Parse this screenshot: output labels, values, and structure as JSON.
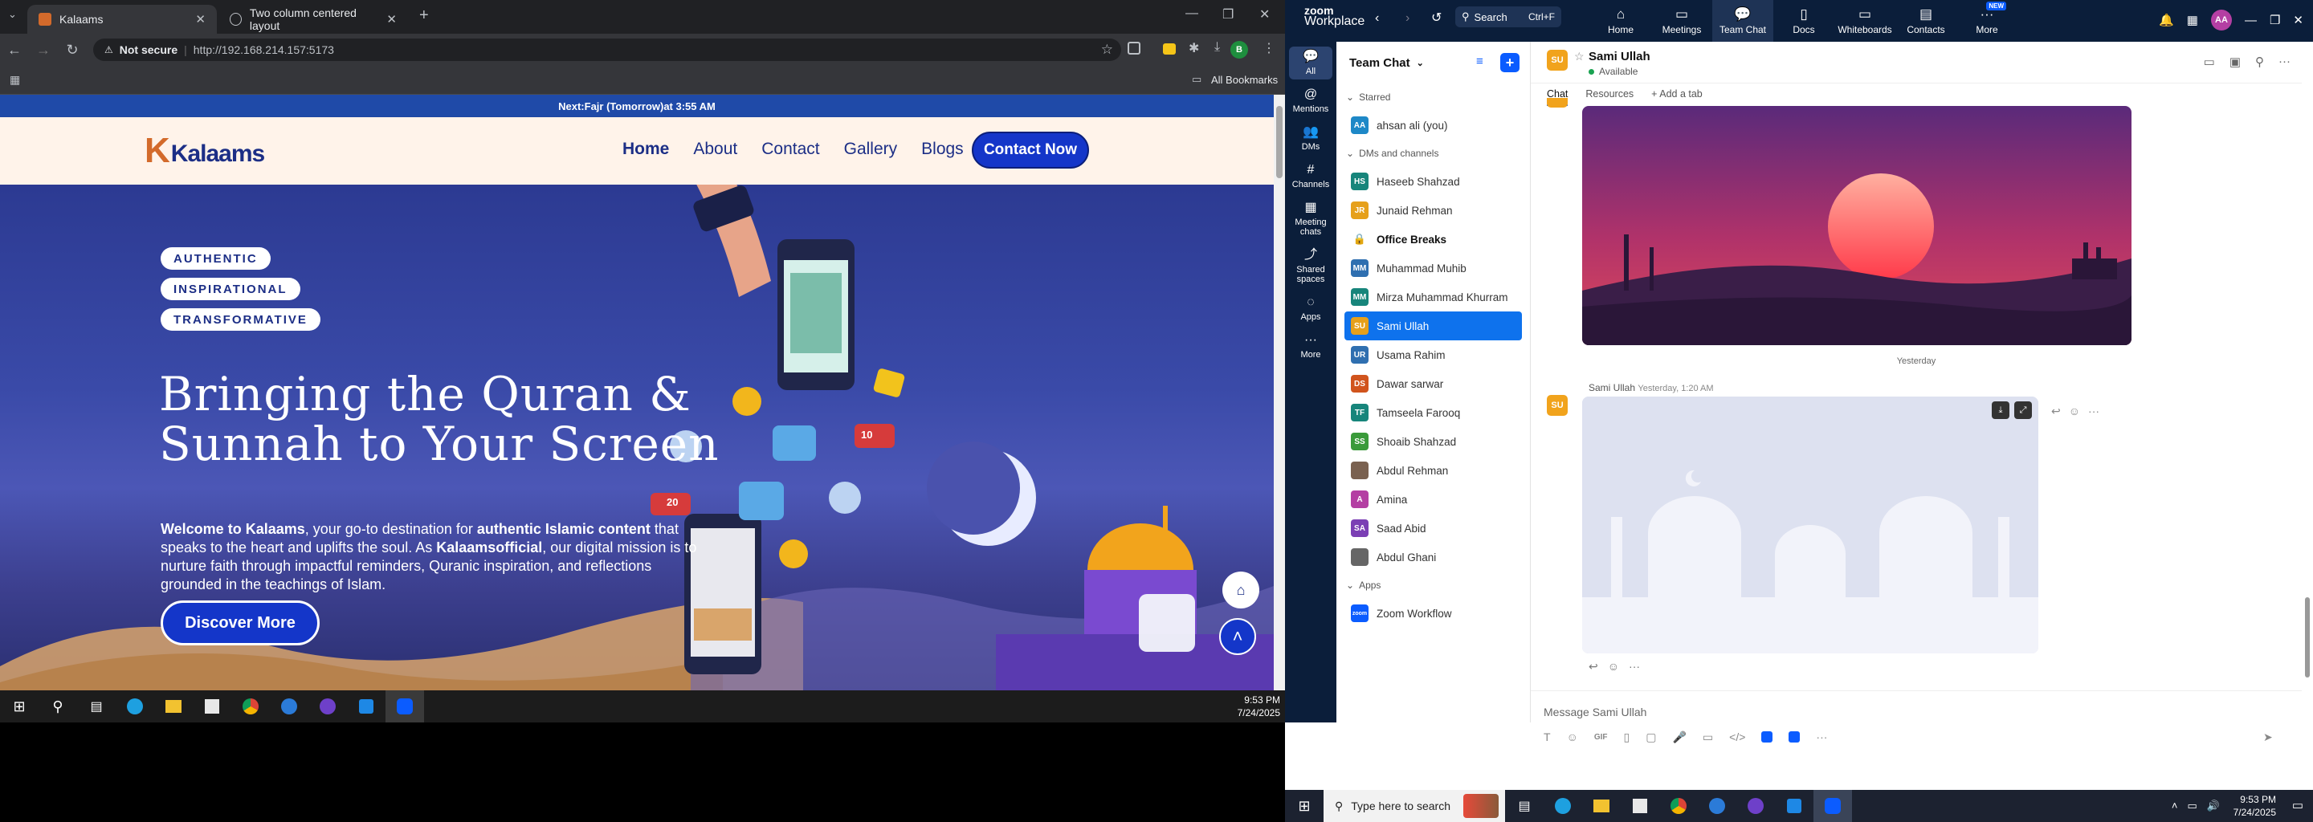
{
  "browser": {
    "tabs": [
      {
        "title": "Kalaams",
        "active": true
      },
      {
        "title": "Two column centered layout",
        "active": false
      }
    ],
    "address": {
      "security": "Not secure",
      "url": "http://192.168.214.157:5173"
    },
    "bookmarks_label": "All Bookmarks",
    "profile_initial": "B"
  },
  "site": {
    "prayer_bar": {
      "prefix": "Next: ",
      "prayer": "Fajr (Tomorrow)",
      "suffix": " at 3:55 AM"
    },
    "logo": {
      "mark": "K",
      "text": "Kalaams"
    },
    "nav": [
      "Home",
      "About",
      "Contact",
      "Gallery",
      "Blogs"
    ],
    "cta": "Contact Now",
    "chips": [
      "AUTHENTIC",
      "INSPIRATIONAL",
      "TRANSFORMATIVE"
    ],
    "headline": [
      "Bringing the Quran &",
      "Sunnah to Your Screen"
    ],
    "lead": {
      "p1": "Welcome to Kalaams",
      "p2": ", your go-to destination for ",
      "p3": "authentic Islamic content",
      "p4": " that speaks to the heart and uplifts the soul. As ",
      "p5": "Kalaamsofficial",
      "p6": ", our digital mission is to nurture faith through impactful reminders, Quranic inspiration, and reflections grounded in the teachings of Islam."
    },
    "discover": "Discover More",
    "deco": {
      "like_count": "20",
      "hearts": "10"
    }
  },
  "left_taskbar": {
    "time": "9:53 PM",
    "date": "7/24/2025"
  },
  "zoom": {
    "brand_top": "zoom",
    "brand_bottom": "Workplace",
    "search": {
      "label": "Search",
      "shortcut": "Ctrl+F"
    },
    "nav": [
      {
        "label": "Home",
        "icon": "home-icon"
      },
      {
        "label": "Meetings",
        "icon": "video-icon"
      },
      {
        "label": "Team Chat",
        "icon": "chat-icon",
        "active": true
      },
      {
        "label": "Docs",
        "icon": "doc-icon"
      },
      {
        "label": "Whiteboards",
        "icon": "whiteboard-icon"
      },
      {
        "label": "Contacts",
        "icon": "contacts-icon"
      },
      {
        "label": "More",
        "icon": "more-icon",
        "badge": "NEW"
      }
    ],
    "avatar": "AA",
    "rail": [
      {
        "label": "All",
        "active": true
      },
      {
        "label": "Mentions"
      },
      {
        "label": "DMs"
      },
      {
        "label": "Channels"
      },
      {
        "label": "Meeting chats"
      },
      {
        "label": "Shared spaces"
      },
      {
        "label": "Apps"
      },
      {
        "label": "More"
      }
    ],
    "list_title": "Team Chat",
    "sections": {
      "starred": "Starred",
      "dms": "DMs and channels",
      "apps": "Apps"
    },
    "starred": [
      {
        "name": "ahsan ali (you)",
        "initials": "AA",
        "color": "#1e88c7"
      }
    ],
    "dms": [
      {
        "name": "Haseeb Shahzad",
        "initials": "HS",
        "color": "#17857b"
      },
      {
        "name": "Junaid Rehman",
        "initials": "JR",
        "color": "#e6a01b"
      },
      {
        "name": "Office Breaks",
        "initials": "",
        "color": "#555",
        "channel": true
      },
      {
        "name": "Muhammad Muhib",
        "initials": "MM",
        "color": "#2f6fb0"
      },
      {
        "name": "Mirza Muhammad Khurram",
        "initials": "MM",
        "color": "#17857b"
      },
      {
        "name": "Sami Ullah",
        "initials": "SU",
        "color": "#e6a01b",
        "selected": true
      },
      {
        "name": "Usama Rahim",
        "initials": "UR",
        "color": "#2f6fb0"
      },
      {
        "name": "Dawar sarwar",
        "initials": "DS",
        "color": "#d1541d"
      },
      {
        "name": "Tamseela Farooq",
        "initials": "TF",
        "color": "#17857b"
      },
      {
        "name": "Shoaib Shahzad",
        "initials": "SS",
        "color": "#3a9a3a"
      },
      {
        "name": "Abdul Rehman",
        "initials": "",
        "color": "#7a6150"
      },
      {
        "name": "Amina",
        "initials": "A",
        "color": "#b43fa3"
      },
      {
        "name": "Saad Abid",
        "initials": "SA",
        "color": "#7b3fb4"
      },
      {
        "name": "Abdul Ghani",
        "initials": "",
        "color": "#666"
      }
    ],
    "apps": [
      {
        "name": "Zoom Workflow",
        "initials": "zoom",
        "color": "#0b5cff"
      }
    ],
    "chat": {
      "name": "Sami Ullah",
      "status": "Available",
      "initials": "SU",
      "tabs": [
        "Chat",
        "Resources",
        "+ Add a tab"
      ],
      "day_divider": "Yesterday",
      "sender": "Sami Ullah",
      "sent_time": "Yesterday, 1:20 AM",
      "composer_placeholder": "Message Sami Ullah"
    }
  },
  "right_taskbar": {
    "search_placeholder": "Type here to search",
    "time": "9:53 PM",
    "date": "7/24/2025"
  }
}
